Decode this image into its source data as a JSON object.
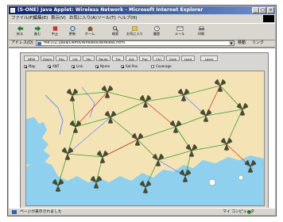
{
  "window": {
    "title": "(S-ONE) Java Applet: Wireless Network - Microsoft Internet Explorer"
  },
  "menu": {
    "items": [
      "ファイル(F)",
      "編集(E)",
      "表示(V)",
      "お気に入り(A)",
      "ツール(T)",
      "ヘルプ(H)"
    ]
  },
  "toolbar": {
    "buttons": [
      {
        "label": "戻る",
        "icon": "back-arrow-icon"
      },
      {
        "label": "進む",
        "icon": "forward-arrow-icon"
      },
      {
        "label": "中止",
        "icon": "stop-icon"
      },
      {
        "label": "更新",
        "icon": "refresh-icon"
      },
      {
        "label": "ホーム",
        "icon": "home-icon"
      },
      {
        "label": "検索",
        "icon": "search-icon"
      },
      {
        "label": "お気に入り",
        "icon": "favorites-icon"
      },
      {
        "label": "履歴",
        "icon": "history-icon"
      },
      {
        "label": "メール",
        "icon": "mail-icon"
      },
      {
        "label": "印刷",
        "icon": "print-icon"
      }
    ]
  },
  "address": {
    "label": "アドレス(D)",
    "value": "file:///Z:/Java/Demo/Wireless/Wireless.html",
    "go_label": "移動",
    "links_label": "リンク"
  },
  "applet": {
    "buttons": [
      "NEW",
      "Zoom",
      "Pan",
      "Init",
      "Stp",
      "Route",
      "Frq",
      "Ant",
      "Pwr",
      "Ctrl",
      "Grph",
      "Load",
      "Layer"
    ],
    "checkboxes": [
      {
        "label": "Map",
        "checked": true
      },
      {
        "label": "ANT",
        "checked": true
      },
      {
        "label": "Link",
        "checked": true
      },
      {
        "label": "Name",
        "checked": true
      },
      {
        "label": "Sat Pos",
        "checked": true
      },
      {
        "label": "Coverage",
        "checked": false
      }
    ],
    "map": {
      "colors": {
        "land": "#f4e4b5",
        "water": "#8fd0ef",
        "antenna": "#4b4a32",
        "link_green": "#3a9a2f",
        "link_red": "#d43d2b",
        "link_blue": "#6b8cff"
      }
    }
  },
  "status": {
    "text": "ページが表示されました",
    "zone": "マイ コンピュータ"
  }
}
